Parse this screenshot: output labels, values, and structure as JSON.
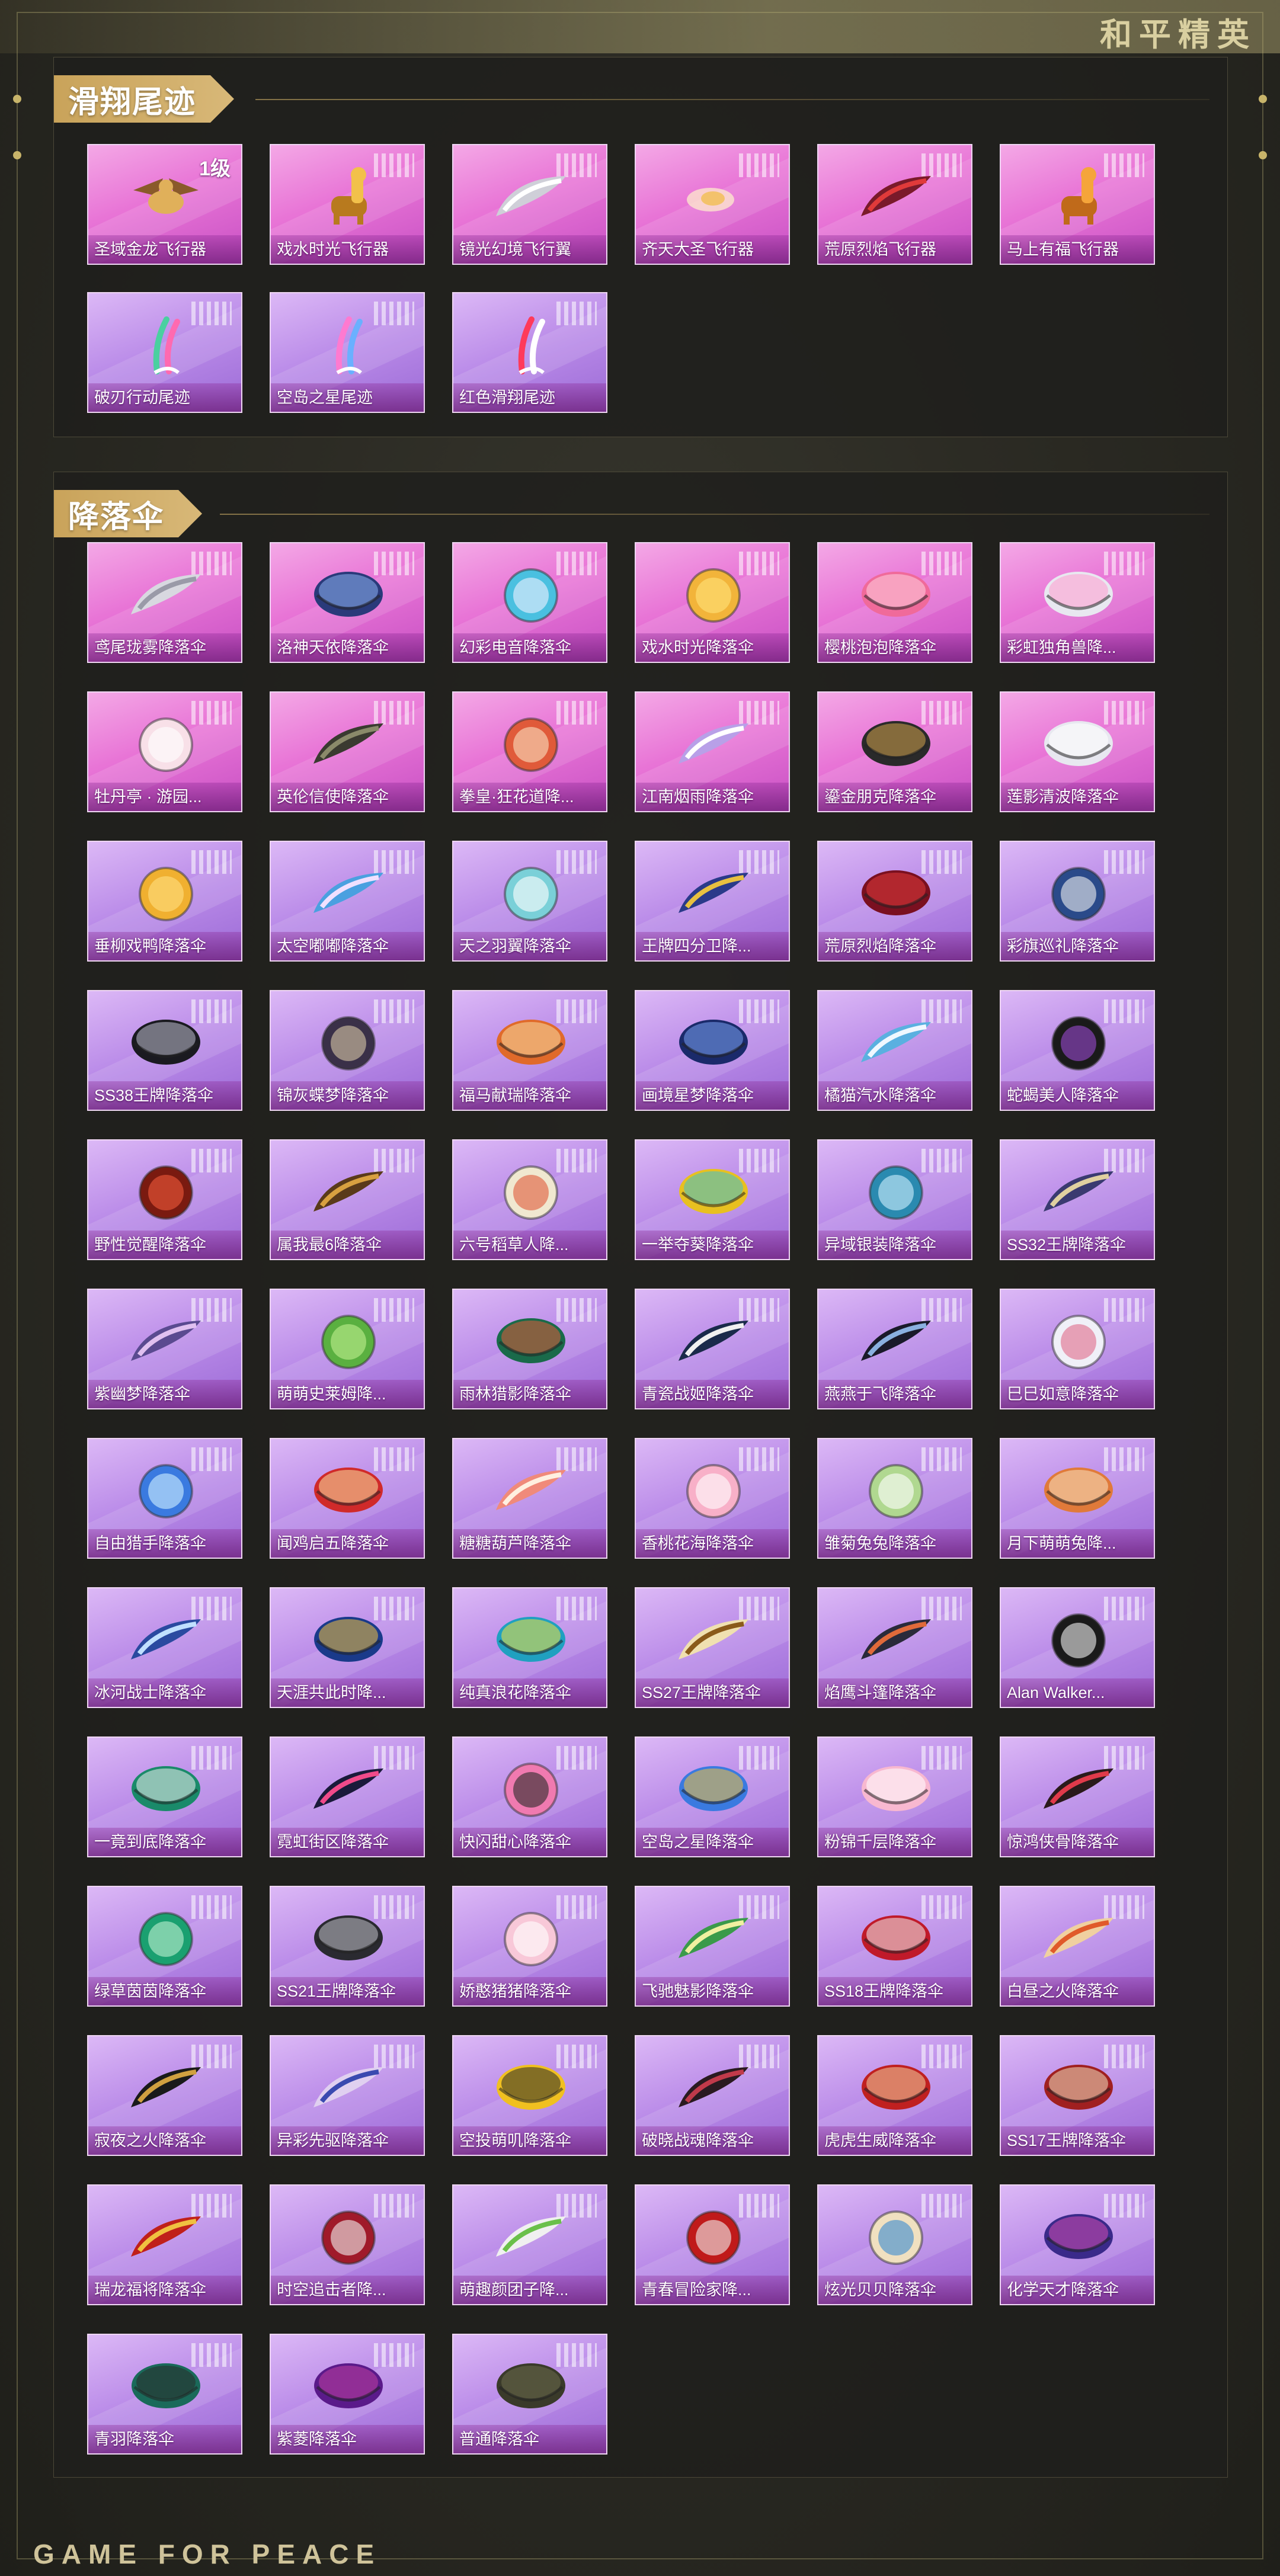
{
  "brand": {
    "title": "和平精英",
    "footer": "GAME FOR PEACE"
  },
  "colors": {
    "card_pink": "#e874d6",
    "card_purple": "#b98ae8",
    "header_gold": "#c9a35a"
  },
  "sections": [
    {
      "title": "滑翔尾迹",
      "items": [
        {
          "label": "圣域金龙飞行器",
          "badge": "1级",
          "tone": "hot",
          "icon": "dragon-icon",
          "art": "dragon",
          "c1": "#8a5a2a",
          "c2": "#e0b05a"
        },
        {
          "label": "戏水时光飞行器",
          "tone": "hot",
          "icon": "giraffe-icon",
          "art": "giraffe",
          "c1": "#b87a1e",
          "c2": "#f2c14a"
        },
        {
          "label": "镜光幻境飞行翼",
          "tone": "hot",
          "icon": "wings-icon",
          "art": "wing",
          "c1": "#cfcfd8",
          "c2": "#ffffff"
        },
        {
          "label": "齐天大圣飞行器",
          "tone": "hot",
          "icon": "cloud-icon",
          "art": "glow",
          "c1": "#f3c26b",
          "c2": "#fff3cc"
        },
        {
          "label": "荒原烈焰飞行器",
          "tone": "hot",
          "icon": "flame-craft-icon",
          "art": "wing",
          "c1": "#7a1a2a",
          "c2": "#e03a3a"
        },
        {
          "label": "马上有福飞行器",
          "tone": "hot",
          "icon": "horse-icon",
          "art": "giraffe",
          "c1": "#c06a1a",
          "c2": "#f5a53a"
        },
        {
          "label": "破刃行动尾迹",
          "tone": "cool",
          "icon": "trail-icon",
          "art": "trail",
          "c1": "#4ad0a0",
          "c2": "#ff6ab0"
        },
        {
          "label": "空岛之星尾迹",
          "tone": "cool",
          "icon": "trail-icon",
          "art": "trail",
          "c1": "#ff7ad0",
          "c2": "#6ab0ff"
        },
        {
          "label": "红色滑翔尾迹",
          "tone": "cool",
          "icon": "trail-icon",
          "art": "trail",
          "c1": "#ff3a5a",
          "c2": "#ffffff"
        }
      ]
    },
    {
      "title": "降落伞",
      "items": [
        {
          "label": "鸢尾珑雾降落伞",
          "tone": "hot",
          "icon": "parachute-icon",
          "art": "wing",
          "c1": "#d8d8e0",
          "c2": "#9a9aa8"
        },
        {
          "label": "洛神天依降落伞",
          "tone": "hot",
          "icon": "parachute-icon",
          "art": "dome",
          "c1": "#2a3a7a",
          "c2": "#8ab0f0"
        },
        {
          "label": "幻彩电音降落伞",
          "tone": "hot",
          "icon": "parachute-icon",
          "art": "round",
          "c1": "#4ac0e0",
          "c2": "#f0f0ff"
        },
        {
          "label": "戏水时光降落伞",
          "tone": "hot",
          "icon": "parachute-icon",
          "art": "round",
          "c1": "#f2b43a",
          "c2": "#ffe27a"
        },
        {
          "label": "樱桃泡泡降落伞",
          "tone": "hot",
          "icon": "parachute-icon",
          "art": "dome",
          "c1": "#f06a9a",
          "c2": "#ffd0e0"
        },
        {
          "label": "彩虹独角兽降...",
          "tone": "hot",
          "icon": "parachute-icon",
          "art": "dome",
          "c1": "#e8e8f0",
          "c2": "#ff9ad0"
        },
        {
          "label": "牡丹亭 · 游园...",
          "tone": "hot",
          "icon": "parachute-icon",
          "art": "round",
          "c1": "#f8e0e8",
          "c2": "#ffffff"
        },
        {
          "label": "英伦信使降落伞",
          "tone": "hot",
          "icon": "parachute-icon",
          "art": "wing",
          "c1": "#3a3a30",
          "c2": "#8a8a6a"
        },
        {
          "label": "拳皇·狂花道降...",
          "tone": "hot",
          "icon": "parachute-icon",
          "art": "round",
          "c1": "#e05a3a",
          "c2": "#f8e0c0"
        },
        {
          "label": "江南烟雨降落伞",
          "tone": "hot",
          "icon": "parachute-icon",
          "art": "wing",
          "c1": "#b8a0e8",
          "c2": "#ffffff"
        },
        {
          "label": "鎏金朋克降落伞",
          "tone": "hot",
          "icon": "parachute-icon",
          "art": "dome",
          "c1": "#2a2a2a",
          "c2": "#d0a04a"
        },
        {
          "label": "莲影清波降落伞",
          "tone": "hot",
          "icon": "parachute-icon",
          "art": "dome",
          "c1": "#e8e8f0",
          "c2": "#ffffff"
        },
        {
          "label": "垂柳戏鸭降落伞",
          "tone": "cool",
          "icon": "parachute-icon",
          "art": "round",
          "c1": "#f0b030",
          "c2": "#ffe080"
        },
        {
          "label": "太空嘟嘟降落伞",
          "tone": "cool",
          "icon": "parachute-icon",
          "art": "wing",
          "c1": "#4aa0e0",
          "c2": "#f0e0ff"
        },
        {
          "label": "天之羽翼降落伞",
          "tone": "cool",
          "icon": "parachute-icon",
          "art": "round",
          "c1": "#7ad0d8",
          "c2": "#ffffff"
        },
        {
          "label": "王牌四分卫降...",
          "tone": "cool",
          "icon": "parachute-icon",
          "art": "wing",
          "c1": "#2a3a8a",
          "c2": "#e8c040"
        },
        {
          "label": "荒原烈焰降落伞",
          "tone": "cool",
          "icon": "parachute-icon",
          "art": "dome",
          "c1": "#7a1020",
          "c2": "#e03a3a"
        },
        {
          "label": "彩旗巡礼降落伞",
          "tone": "cool",
          "icon": "parachute-icon",
          "art": "round",
          "c1": "#2a4a8a",
          "c2": "#f0f0f0"
        },
        {
          "label": "SS38王牌降落伞",
          "tone": "cool",
          "icon": "parachute-icon",
          "art": "dome",
          "c1": "#1a1a20",
          "c2": "#c0c0d0"
        },
        {
          "label": "锦灰蝶梦降落伞",
          "tone": "cool",
          "icon": "parachute-icon",
          "art": "round",
          "c1": "#3a3048",
          "c2": "#d8c8a8"
        },
        {
          "label": "福马献瑞降落伞",
          "tone": "cool",
          "icon": "parachute-icon",
          "art": "dome",
          "c1": "#e06a2a",
          "c2": "#f8d8a0"
        },
        {
          "label": "画境星梦降落伞",
          "tone": "cool",
          "icon": "parachute-icon",
          "art": "dome",
          "c1": "#1a2a6a",
          "c2": "#7aa0f0"
        },
        {
          "label": "橘猫汽水降落伞",
          "tone": "cool",
          "icon": "parachute-icon",
          "art": "wing",
          "c1": "#5ab0e0",
          "c2": "#f0f8ff"
        },
        {
          "label": "蛇蝎美人降落伞",
          "tone": "cool",
          "icon": "parachute-icon",
          "art": "round",
          "c1": "#1a1a1a",
          "c2": "#9a4ad0"
        },
        {
          "label": "野性觉醒降落伞",
          "tone": "cool",
          "icon": "parachute-icon",
          "art": "round",
          "c1": "#7a1a10",
          "c2": "#f05a3a"
        },
        {
          "label": "属我最6降落伞",
          "tone": "cool",
          "icon": "parachute-icon",
          "art": "wing",
          "c1": "#5a3a1a",
          "c2": "#d8a040"
        },
        {
          "label": "六号稻草人降...",
          "tone": "cool",
          "icon": "parachute-icon",
          "art": "round",
          "c1": "#f0e8d0",
          "c2": "#e05a3a"
        },
        {
          "label": "一举夺葵降落伞",
          "tone": "cool",
          "icon": "parachute-icon",
          "art": "dome",
          "c1": "#e8c020",
          "c2": "#40c0d0"
        },
        {
          "label": "异域银装降落伞",
          "tone": "cool",
          "icon": "parachute-icon",
          "art": "round",
          "c1": "#2a8ab0",
          "c2": "#d0f0ff"
        },
        {
          "label": "SS32王牌降落伞",
          "tone": "cool",
          "icon": "parachute-icon",
          "art": "wing",
          "c1": "#3a3a70",
          "c2": "#e0d0a0"
        },
        {
          "label": "紫幽梦降落伞",
          "tone": "cool",
          "icon": "parachute-icon",
          "art": "wing",
          "c1": "#5a4a90",
          "c2": "#e0c0f0"
        },
        {
          "label": "萌萌史莱姆降...",
          "tone": "cool",
          "icon": "parachute-icon",
          "art": "round",
          "c1": "#5ab040",
          "c2": "#c0f090"
        },
        {
          "label": "雨林猎影降落伞",
          "tone": "cool",
          "icon": "parachute-icon",
          "art": "dome",
          "c1": "#1a6a4a",
          "c2": "#e05a3a"
        },
        {
          "label": "青瓷战姬降落伞",
          "tone": "cool",
          "icon": "parachute-icon",
          "art": "wing",
          "c1": "#1a2a4a",
          "c2": "#f0f0f0"
        },
        {
          "label": "燕燕于飞降落伞",
          "tone": "cool",
          "icon": "parachute-icon",
          "art": "wing",
          "c1": "#1a1a2a",
          "c2": "#8ab0e0"
        },
        {
          "label": "巳巳如意降落伞",
          "tone": "cool",
          "icon": "parachute-icon",
          "art": "round",
          "c1": "#f0f0f8",
          "c2": "#e06a8a"
        },
        {
          "label": "自由猎手降落伞",
          "tone": "cool",
          "icon": "parachute-icon",
          "art": "round",
          "c1": "#3a7ae0",
          "c2": "#d0f0ff"
        },
        {
          "label": "闻鸡启五降落伞",
          "tone": "cool",
          "icon": "parachute-icon",
          "art": "dome",
          "c1": "#d02a2a",
          "c2": "#f8e0a0"
        },
        {
          "label": "糖糖葫芦降落伞",
          "tone": "cool",
          "icon": "parachute-icon",
          "art": "wing",
          "c1": "#f08a7a",
          "c2": "#fff0e0"
        },
        {
          "label": "香桃花海降落伞",
          "tone": "cool",
          "icon": "parachute-icon",
          "art": "round",
          "c1": "#f8b0c8",
          "c2": "#ffffff"
        },
        {
          "label": "雏菊兔兔降落伞",
          "tone": "cool",
          "icon": "parachute-icon",
          "art": "round",
          "c1": "#b0d890",
          "c2": "#ffffff"
        },
        {
          "label": "月下萌萌兔降...",
          "tone": "cool",
          "icon": "parachute-icon",
          "art": "dome",
          "c1": "#e07a3a",
          "c2": "#f8e0c0"
        },
        {
          "label": "冰河战士降落伞",
          "tone": "cool",
          "icon": "parachute-icon",
          "art": "wing",
          "c1": "#2a4aa0",
          "c2": "#c0e0ff"
        },
        {
          "label": "天涯共此时降...",
          "tone": "cool",
          "icon": "parachute-icon",
          "art": "dome",
          "c1": "#1a3a8a",
          "c2": "#f0c040"
        },
        {
          "label": "纯真浪花降落伞",
          "tone": "cool",
          "icon": "parachute-icon",
          "art": "dome",
          "c1": "#20a0c0",
          "c2": "#f0e040"
        },
        {
          "label": "SS27王牌降落伞",
          "tone": "cool",
          "icon": "parachute-icon",
          "art": "wing",
          "c1": "#f0e0b0",
          "c2": "#8a5a1a"
        },
        {
          "label": "焰鹰斗篷降落伞",
          "tone": "cool",
          "icon": "parachute-icon",
          "art": "wing",
          "c1": "#2a2a3a",
          "c2": "#e06a3a"
        },
        {
          "label": "Alan Walker...",
          "tone": "cool",
          "icon": "parachute-icon",
          "art": "round",
          "c1": "#1a1a1a",
          "c2": "#f0f0f0"
        },
        {
          "label": "一竟到底降落伞",
          "tone": "cool",
          "icon": "parachute-icon",
          "art": "dome",
          "c1": "#1a8a6a",
          "c2": "#f0f0f0"
        },
        {
          "label": "霓虹街区降落伞",
          "tone": "cool",
          "icon": "parachute-icon",
          "art": "wing",
          "c1": "#1a1a3a",
          "c2": "#f04a8a"
        },
        {
          "label": "快闪甜心降落伞",
          "tone": "cool",
          "icon": "parachute-icon",
          "art": "round",
          "c1": "#f07ab0",
          "c2": "#2a2a2a"
        },
        {
          "label": "空岛之星降落伞",
          "tone": "cool",
          "icon": "parachute-icon",
          "art": "dome",
          "c1": "#3a7ae0",
          "c2": "#f0c040"
        },
        {
          "label": "粉锦千层降落伞",
          "tone": "cool",
          "icon": "parachute-icon",
          "art": "dome",
          "c1": "#f8b8d0",
          "c2": "#ffffff"
        },
        {
          "label": "惊鸿侠骨降落伞",
          "tone": "cool",
          "icon": "parachute-icon",
          "art": "wing",
          "c1": "#2a1a1a",
          "c2": "#e03a4a"
        },
        {
          "label": "绿草茵茵降落伞",
          "tone": "cool",
          "icon": "parachute-icon",
          "art": "round",
          "c1": "#1aa070",
          "c2": "#c0f0d0"
        },
        {
          "label": "SS21王牌降落伞",
          "tone": "cool",
          "icon": "parachute-icon",
          "art": "dome",
          "c1": "#2a2a30",
          "c2": "#c0c0c8"
        },
        {
          "label": "娇憨猪猪降落伞",
          "tone": "cool",
          "icon": "parachute-icon",
          "art": "round",
          "c1": "#f8c8d8",
          "c2": "#ffffff"
        },
        {
          "label": "飞驰魅影降落伞",
          "tone": "cool",
          "icon": "parachute-icon",
          "art": "wing",
          "c1": "#3a9a4a",
          "c2": "#f0f0a0"
        },
        {
          "label": "SS18王牌降落伞",
          "tone": "cool",
          "icon": "parachute-icon",
          "art": "dome",
          "c1": "#c01a2a",
          "c2": "#f0f0f0"
        },
        {
          "label": "白昼之火降落伞",
          "tone": "cool",
          "icon": "parachute-icon",
          "art": "wing",
          "c1": "#f0d0a0",
          "c2": "#e05a2a"
        },
        {
          "label": "寂夜之火降落伞",
          "tone": "cool",
          "icon": "parachute-icon",
          "art": "wing",
          "c1": "#1a1a1a",
          "c2": "#d0a040"
        },
        {
          "label": "异彩先驱降落伞",
          "tone": "cool",
          "icon": "parachute-icon",
          "art": "wing",
          "c1": "#e0d0f0",
          "c2": "#3a4ab0"
        },
        {
          "label": "空投萌叽降落伞",
          "tone": "cool",
          "icon": "parachute-icon",
          "art": "dome",
          "c1": "#f0c020",
          "c2": "#2a2a2a"
        },
        {
          "label": "破晓战魂降落伞",
          "tone": "cool",
          "icon": "parachute-icon",
          "art": "wing",
          "c1": "#2a1a20",
          "c2": "#c03a4a"
        },
        {
          "label": "虎虎生威降落伞",
          "tone": "cool",
          "icon": "parachute-icon",
          "art": "dome",
          "c1": "#c02020",
          "c2": "#f0d0a0"
        },
        {
          "label": "SS17王牌降落伞",
          "tone": "cool",
          "icon": "parachute-icon",
          "art": "dome",
          "c1": "#a02020",
          "c2": "#f0e0c0"
        },
        {
          "label": "瑞龙福将降落伞",
          "tone": "cool",
          "icon": "parachute-icon",
          "art": "wing",
          "c1": "#c0201a",
          "c2": "#f0c040"
        },
        {
          "label": "时空追击者降...",
          "tone": "cool",
          "icon": "parachute-icon",
          "art": "round",
          "c1": "#a01a2a",
          "c2": "#f0f0f0"
        },
        {
          "label": "萌趣颜团子降...",
          "tone": "cool",
          "icon": "parachute-icon",
          "art": "wing",
          "c1": "#f0f0f0",
          "c2": "#6ac04a"
        },
        {
          "label": "青春冒险家降...",
          "tone": "cool",
          "icon": "parachute-icon",
          "art": "round",
          "c1": "#c01a1a",
          "c2": "#f0f0f0"
        },
        {
          "label": "炫光贝贝降落伞",
          "tone": "cool",
          "icon": "parachute-icon",
          "art": "round",
          "c1": "#f0e0c0",
          "c2": "#3a8ad0"
        },
        {
          "label": "化学天才降落伞",
          "tone": "cool",
          "icon": "parachute-icon",
          "art": "dome",
          "c1": "#3a2a8a",
          "c2": "#d04ab0"
        },
        {
          "label": "青羽降落伞",
          "tone": "cool",
          "icon": "parachute-icon",
          "art": "dome",
          "c1": "#1a6a5a",
          "c2": "#2a2a2a"
        },
        {
          "label": "紫菱降落伞",
          "tone": "cool",
          "icon": "parachute-icon",
          "art": "dome",
          "c1": "#5a1a8a",
          "c2": "#c040a0"
        },
        {
          "label": "普通降落伞",
          "tone": "cool",
          "icon": "parachute-icon",
          "art": "dome",
          "c1": "#3a3a2a",
          "c2": "#6a6a4a"
        }
      ]
    }
  ]
}
